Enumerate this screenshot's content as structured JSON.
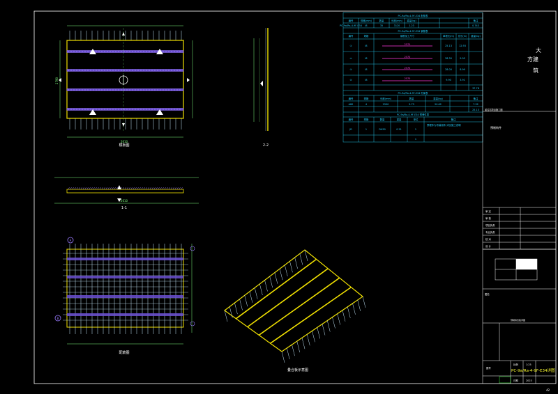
{
  "colors": {
    "background": "#000000",
    "frame": "#ffffff",
    "panel_outline": "#f0e000",
    "rebar": "#9a7bff",
    "rebar_fill": "#6a4fd0",
    "vertical_bar": "#c8ecff",
    "dimension": "#7fff7f",
    "table_line": "#22bde0",
    "table_text": "#22d0ff",
    "magenta": "#ff3ce0",
    "title_yellow": "#ffff33",
    "titleblock_line": "#ffffff",
    "green_text": "#3cff3c",
    "iso_panel": "#f0e000"
  },
  "views": {
    "plan_label": "模板图",
    "section_11_label": "1-1",
    "section_22_label": "2-2",
    "rebar_plan_label": "配筋图",
    "iso_label": "叠合板示意图",
    "dim_total": "2610",
    "dim_side": "2790",
    "dim_11": "2610",
    "marker_a": "A",
    "marker_b": "B"
  },
  "schedule": {
    "table1_title": "PC-9a/Ra-4-9F-E34 配筋表",
    "table1_headers": [
      "编号",
      "规格(mm)",
      "数量",
      "长度(mm)",
      "重量(kg)",
      "备注"
    ],
    "table1_row": [
      "PC-9a/Ra-4-9F-E34",
      "Ⅰ8",
      "35",
      "3120",
      "1.23",
      "0.743"
    ],
    "table2_title": "PC-9a/Ra-4-9F-E34 钢筋表",
    "table2_headers": [
      "编号",
      "规格",
      "钢筋加工尺寸",
      "单根长(m)",
      "总长(m)",
      "重量(kg)"
    ],
    "table2_rows": [
      {
        "id": "①",
        "spec": "Ⅰ8",
        "len": "2570",
        "total": "25.13",
        "weight": "12.93"
      },
      {
        "id": "②",
        "spec": "Ⅰ8",
        "len": "2570",
        "total": "28.30",
        "weight": "9.95"
      },
      {
        "id": "③",
        "spec": "Ⅰ8",
        "len": "2570",
        "total": "28.00",
        "weight": "8.99"
      },
      {
        "id": "④",
        "spec": "Ⅰ8",
        "len": "2570",
        "total": "9.90",
        "weight": "3.91"
      }
    ],
    "table2_sum": "37.78",
    "table3_title": "PC-9a/Ra-4-9F-E34 桁架表",
    "table3_headers": [
      "编号",
      "规格",
      "长度(mm)",
      "数量",
      "重量(kg)",
      "备注"
    ],
    "table3_row": [
      "A80",
      "4",
      "2590",
      "5.73",
      "20.62",
      "7.52"
    ],
    "table3_sum": "25.13",
    "table4_title": "PC-9a/Ra-4-9F-E34 预埋件表",
    "table4_headers": [
      "编号",
      "规格",
      "数量",
      "重量",
      "单位",
      "备注"
    ],
    "table4_row": [
      "JD",
      "1",
      "DH30",
      "0.21",
      "1",
      "1"
    ],
    "table4_note": "预埋件为吊装用件,详见施工说明",
    "table4_last": "1"
  },
  "titleblock": {
    "company_line1": "大",
    "company_line2": "方建",
    "company_line3": "筑",
    "project_label": "某住宅项目施工图",
    "stage_label": "预制构件",
    "rows": [
      "审 定",
      "审 核",
      "项目负责",
      "专业负责",
      "校 对",
      "设 计"
    ],
    "drawing_label": "图名",
    "sub_label": "预制叠合板详图",
    "code_label": "图号",
    "scale_label": "比例",
    "scale_value": "1:25",
    "title_code": "PC-9a/Ra-4-9F-E34详图",
    "date_label": "日期",
    "date_value": "2023",
    "sheet_no": "42"
  }
}
